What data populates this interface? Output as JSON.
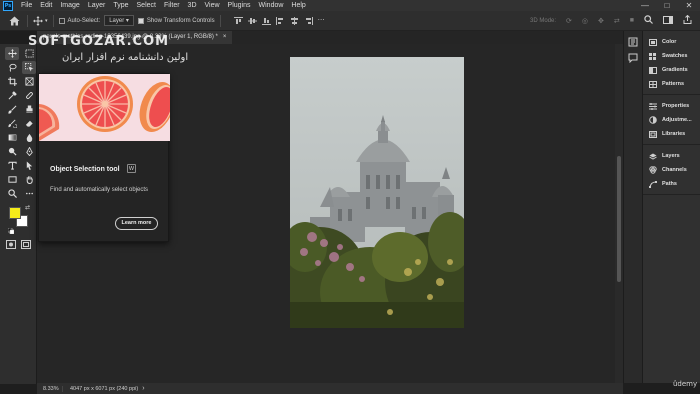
{
  "app": {
    "logo_text": "Ps",
    "accent_color": "#31a8ff"
  },
  "menu": {
    "items": [
      "File",
      "Edit",
      "Image",
      "Layer",
      "Type",
      "Select",
      "Filter",
      "3D",
      "View",
      "Plugins",
      "Window",
      "Help"
    ]
  },
  "window_controls": {
    "minimize": "—",
    "maximize": "□",
    "close": "✕"
  },
  "options": {
    "auto_select_label": "Auto-Select:",
    "auto_select_value": "Layer",
    "show_transform_label": "Show Transform Controls",
    "mode_3d_label": "3D Mode:"
  },
  "document": {
    "tab_title": "pexels-mathias-reding-13356439.jpg @ 8.33% (Layer 1, RGB/8) *",
    "close_glyph": "×"
  },
  "status": {
    "zoom": "8.33%",
    "dimensions": "4047 px x 6071 px (240 ppi)",
    "arrow_glyph": "›"
  },
  "tooltip": {
    "title": "Object Selection tool",
    "shortcut": "W",
    "description": "Find and automatically select objects",
    "button": "Learn more"
  },
  "panels": {
    "group1": [
      "Color",
      "Swatches",
      "Gradients",
      "Patterns"
    ],
    "group2": [
      "Properties",
      "Adjustme...",
      "Libraries"
    ],
    "group3": [
      "Layers",
      "Channels",
      "Paths"
    ]
  },
  "watermark": {
    "line1": "SOFTGOZAR.COM",
    "line2": "اولین دانشنامه نرم افزار ایران"
  },
  "udemy_label": "ûdemy",
  "colors": {
    "foreground": "#f5ec1a",
    "background": "#ffffff"
  }
}
